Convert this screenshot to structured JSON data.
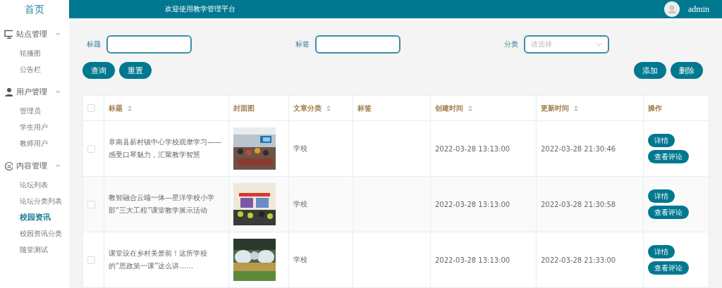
{
  "sidebar": {
    "home": "首页",
    "groups": [
      {
        "title": "站点管理",
        "expanded": true,
        "items": [
          {
            "label": "轮播图",
            "selected": false
          },
          {
            "label": "公告栏",
            "selected": false
          }
        ]
      },
      {
        "title": "用户管理",
        "expanded": true,
        "items": [
          {
            "label": "管理员",
            "selected": false
          },
          {
            "label": "学生用户",
            "selected": false
          },
          {
            "label": "教师用户",
            "selected": false
          }
        ]
      },
      {
        "title": "内容管理",
        "expanded": true,
        "items": [
          {
            "label": "论坛列表",
            "selected": false
          },
          {
            "label": "论坛分类列表",
            "selected": false
          },
          {
            "label": "校园资讯",
            "selected": true
          },
          {
            "label": "校园资讯分类",
            "selected": false
          },
          {
            "label": "随堂测试",
            "selected": false
          }
        ]
      }
    ]
  },
  "header": {
    "welcome": "欢迎使用教学管理平台",
    "user": "admin"
  },
  "filters": [
    {
      "label": "标题",
      "kind": "text"
    },
    {
      "label": "标签",
      "kind": "text"
    },
    {
      "label": "分类",
      "kind": "select",
      "placeholder": "请选择"
    }
  ],
  "left_buttons": [
    "查询",
    "重置"
  ],
  "right_buttons": [
    "添加",
    "删除"
  ],
  "table": {
    "select_all_checked": false,
    "columns": [
      {
        "label": "标题",
        "sortable": true
      },
      {
        "label": "封面图",
        "sortable": false
      },
      {
        "label": "文章分类",
        "sortable": true
      },
      {
        "label": "标签",
        "sortable": false
      },
      {
        "label": "创建时间",
        "sortable": true
      },
      {
        "label": "更新时间",
        "sortable": true
      },
      {
        "label": "操作",
        "sortable": false
      }
    ],
    "rows": [
      {
        "title": "阜南县新村镇中心学校观摩学习——感受口琴魅力，汇聚教学智慧",
        "checked": false,
        "cover": {
          "kind": "picture"
        },
        "category": "学校",
        "created": "2022-03-28 13:13:00",
        "updated": "2022-03-28 21:30:46",
        "actions": [
          "详情",
          "查看评论"
        ]
      },
      {
        "title": "教智融合云端一体—星洋学校小学部“三大工程”课堂教学展示活动",
        "checked": false,
        "cover": {
          "kind": "picture"
        },
        "category": "学校",
        "created": "2022-03-28 13:13:00",
        "updated": "2022-03-28 21:30:58",
        "actions": [
          "详情",
          "查看评论"
        ]
      },
      {
        "title": "课堂设在乡村美景前！这所学校的“思政第一课”这么讲……",
        "checked": false,
        "cover": {
          "kind": "picture"
        },
        "category": "学校",
        "created": "2022-03-28 13:13:00",
        "updated": "2022-03-28 21:33:00",
        "actions": [
          "详情",
          "查看评论"
        ]
      }
    ]
  }
}
